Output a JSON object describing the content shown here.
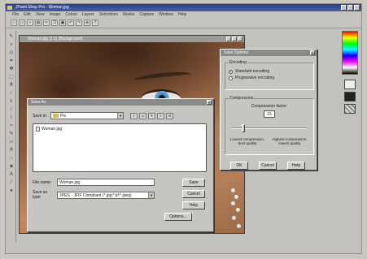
{
  "app": {
    "title": "JPaint Shop Pro - Woman.jpg"
  },
  "menu": [
    "File",
    "Edit",
    "View",
    "Image",
    "Colors",
    "Layers",
    "Selections",
    "Masks",
    "Capture",
    "Window",
    "Help"
  ],
  "toolbar_icons": [
    "new-icon",
    "open-icon",
    "save-icon",
    "print-icon",
    "cut-icon",
    "copy-icon",
    "paste-icon",
    "undo-icon",
    "redo-icon",
    "zoom-icon",
    "help-icon"
  ],
  "tools": [
    "arrow-tool",
    "zoom-tool",
    "deform-tool",
    "crop-tool",
    "mover-tool",
    "select-tool",
    "lasso-tool",
    "wand-tool",
    "dropper-tool",
    "brush-tool",
    "clone-tool",
    "replace-tool",
    "retouch-tool",
    "eraser-tool",
    "picture-tube-tool",
    "airbrush-tool",
    "flood-fill-tool",
    "text-tool",
    "draw-tool",
    "shape-tool"
  ],
  "image_window": {
    "title": "Woman.jpg [1:1] (Background)"
  },
  "open_dialog": {
    "title": "Save As",
    "look_in_label": "Save in:",
    "look_in_value": "Pix",
    "files": [
      "Woman.jpg"
    ],
    "file_name_label": "File name:",
    "file_name_value": "Woman.jpg",
    "file_type_label": "Save as type:",
    "file_type_value": "JPEG - JFIF Compliant (*.jpg;*.jif;*.jpeg)",
    "buttons": {
      "save": "Save",
      "cancel": "Cancel",
      "help": "Help",
      "options": "Options..."
    }
  },
  "save_options": {
    "title": "Save Options",
    "encoding_label": "Encoding",
    "standard_encoding": "Standard encoding",
    "progressive_encoding": "Progressive encoding",
    "selected_encoding": "standard",
    "compression_label": "Compression",
    "compression_factor_label": "Compression factor:",
    "compression_factor_value": "15",
    "compression_level": 0.15,
    "low_hint": "Lowest compression, best quality",
    "high_hint": "Highest compression, lowest quality",
    "buttons": {
      "ok": "OK",
      "cancel": "Cancel",
      "help": "Help"
    }
  }
}
